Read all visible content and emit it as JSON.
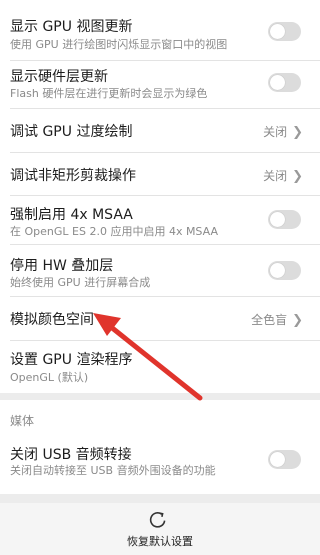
{
  "settings": {
    "gpu_view_updates": {
      "title": "显示 GPU 视图更新",
      "subtitle": "使用 GPU 进行绘图时闪烁显示窗口中的视图",
      "enabled": false
    },
    "hw_layer_updates": {
      "title": "显示硬件层更新",
      "subtitle": "Flash 硬件层在进行更新时会显示为绿色",
      "enabled": false
    },
    "debug_gpu_overdraw": {
      "title": "调试 GPU 过度绘制",
      "value": "关闭"
    },
    "debug_nonrect_clip": {
      "title": "调试非矩形剪裁操作",
      "value": "关闭"
    },
    "force_4x_msaa": {
      "title": "强制启用 4x MSAA",
      "subtitle": "在 OpenGL ES 2.0 应用中启用 4x MSAA",
      "enabled": false
    },
    "disable_hw_overlays": {
      "title": "停用 HW 叠加层",
      "subtitle": "始终使用 GPU 进行屏幕合成",
      "enabled": false
    },
    "simulate_color_space": {
      "title": "模拟颜色空间",
      "value": "全色盲"
    },
    "gpu_renderer": {
      "title": "设置 GPU 渲染程序",
      "subtitle": "OpenGL (默认)"
    }
  },
  "media_section": {
    "header": "媒体",
    "usb_audio_routing": {
      "title": "关闭 USB 音频转接",
      "subtitle": "关闭自动转接至 USB 音频外围设备的功能",
      "enabled": false
    }
  },
  "bottom_bar": {
    "reset_label": "恢复默认设置"
  },
  "colors": {
    "annotation_arrow": "#e0342c",
    "toggle_off": "#dcdcdc"
  }
}
